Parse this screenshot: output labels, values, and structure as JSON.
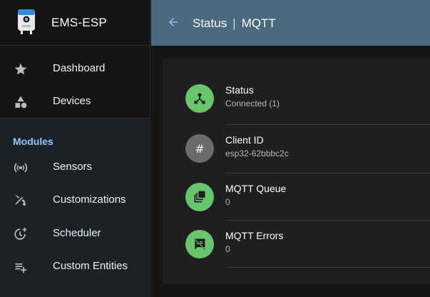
{
  "app": {
    "name": "EMS-ESP"
  },
  "sidebar": {
    "items": [
      {
        "label": "Dashboard",
        "icon": "star-icon"
      },
      {
        "label": "Devices",
        "icon": "category-icon"
      }
    ],
    "modules_title": "Modules",
    "modules": [
      {
        "label": "Sensors",
        "icon": "sensors-icon"
      },
      {
        "label": "Customizations",
        "icon": "build-icon"
      },
      {
        "label": "Scheduler",
        "icon": "more-time-icon"
      },
      {
        "label": "Custom Entities",
        "icon": "playlist-add-icon"
      }
    ]
  },
  "header": {
    "section": "Status",
    "separator": "|",
    "page": "MQTT"
  },
  "status_list": [
    {
      "title": "Status",
      "value": "Connected (1)",
      "icon": "device-hub-icon",
      "color": "#68c46d"
    },
    {
      "title": "Client ID",
      "value": "esp32-62bbbc2c",
      "icon": "hash-icon",
      "color": "#6b6b6b"
    },
    {
      "title": "MQTT Queue",
      "value": "0",
      "icon": "queue-icon",
      "color": "#68c46d"
    },
    {
      "title": "MQTT Errors",
      "value": "0",
      "icon": "speaker-notes-off-icon",
      "color": "#68c46d"
    }
  ],
  "colors": {
    "header": "#4b6a7f",
    "accent": "#90caf9",
    "success": "#68c46d"
  }
}
